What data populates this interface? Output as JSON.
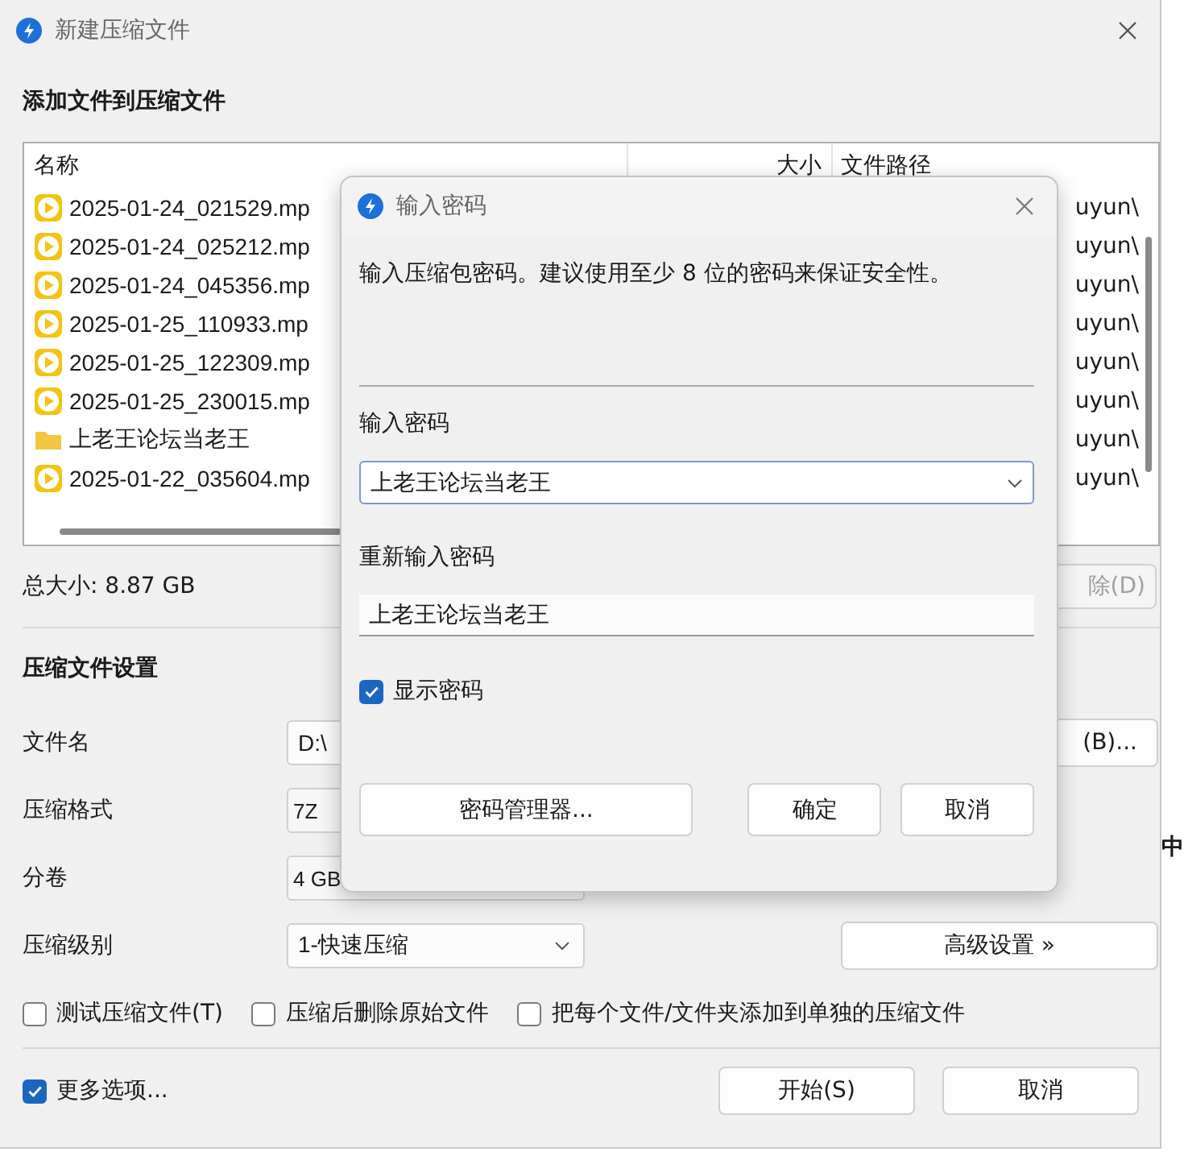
{
  "window": {
    "title": "新建压缩文件"
  },
  "add_section": {
    "heading": "添加文件到压缩文件"
  },
  "file_list": {
    "columns": [
      "名称",
      "大小",
      "文件路径"
    ],
    "rows": [
      {
        "kind": "video",
        "name": "2025-01-24_021529.mp",
        "path": "uyun\\"
      },
      {
        "kind": "video",
        "name": "2025-01-24_025212.mp",
        "path": "uyun\\"
      },
      {
        "kind": "video",
        "name": "2025-01-24_045356.mp",
        "path": "uyun\\"
      },
      {
        "kind": "video",
        "name": "2025-01-25_110933.mp",
        "path": "uyun\\"
      },
      {
        "kind": "video",
        "name": "2025-01-25_122309.mp",
        "path": "uyun\\"
      },
      {
        "kind": "video",
        "name": "2025-01-25_230015.mp",
        "path": "uyun\\"
      },
      {
        "kind": "folder",
        "name": "上老王论坛当老王",
        "path": "uyun\\"
      },
      {
        "kind": "video",
        "name": "2025-01-22_035604.mp",
        "path": "uyun\\"
      }
    ],
    "total": "总大小: 8.87 GB",
    "remove_button": "除(D)"
  },
  "settings": {
    "heading": "压缩文件设置",
    "fields": [
      {
        "kind": "text",
        "label": "文件名",
        "value": "D:\\",
        "button": "(B)..."
      },
      {
        "kind": "combo",
        "label": "压缩格式",
        "value": "7Z"
      },
      {
        "kind": "combo",
        "label": "分卷",
        "value": "4 GB"
      },
      {
        "kind": "select",
        "label": "压缩级别",
        "value": "1-快速压缩",
        "button": "高级设置 »"
      }
    ],
    "options": [
      {
        "label": "测试压缩文件(T)",
        "checked": false
      },
      {
        "label": "压缩后删除原始文件",
        "checked": false
      },
      {
        "label": "把每个文件/文件夹添加到单独的压缩文件",
        "checked": false
      }
    ]
  },
  "footer": {
    "more_options": {
      "label": "更多选项...",
      "checked": true
    },
    "buttons": [
      "开始(S)",
      "取消"
    ]
  },
  "dialog": {
    "title": "输入密码",
    "message": "输入压缩包密码。建议使用至少 8 位的密码来保证安全性。",
    "password_label": "输入密码",
    "password": "上老王论坛当老王",
    "confirm_label": "重新输入密码",
    "confirm": "上老王论坛当老王",
    "show_password": {
      "label": "显示密码",
      "checked": true
    },
    "manager_button": "密码管理器...",
    "buttons": [
      "确定",
      "取消"
    ]
  },
  "desktop": {
    "text": "中"
  }
}
